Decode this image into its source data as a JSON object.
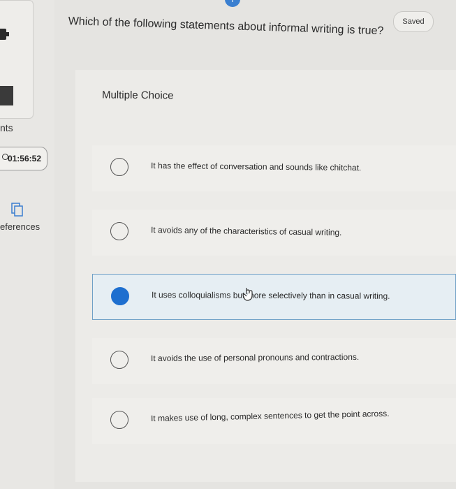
{
  "sidebar": {
    "points_label": "nts",
    "timer": "01:56:52",
    "references_label": "eferences"
  },
  "header": {
    "saved_label": "Saved"
  },
  "question": {
    "text": "Which of the following statements about informal writing is true?",
    "type_label": "Multiple Choice"
  },
  "options": [
    {
      "text": "It has the effect of conversation and sounds like chitchat.",
      "selected": false
    },
    {
      "text": "It avoids any of the characteristics of casual writing.",
      "selected": false
    },
    {
      "text": "It uses colloquialisms but more selectively than in casual writing.",
      "selected": true
    },
    {
      "text": "It avoids the use of personal pronouns and contractions.",
      "selected": false
    },
    {
      "text": "It makes use of long, complex sentences to get the point across.",
      "selected": false
    }
  ],
  "colors": {
    "accent": "#1e6fcf",
    "selected_border": "#6fa0c6"
  }
}
